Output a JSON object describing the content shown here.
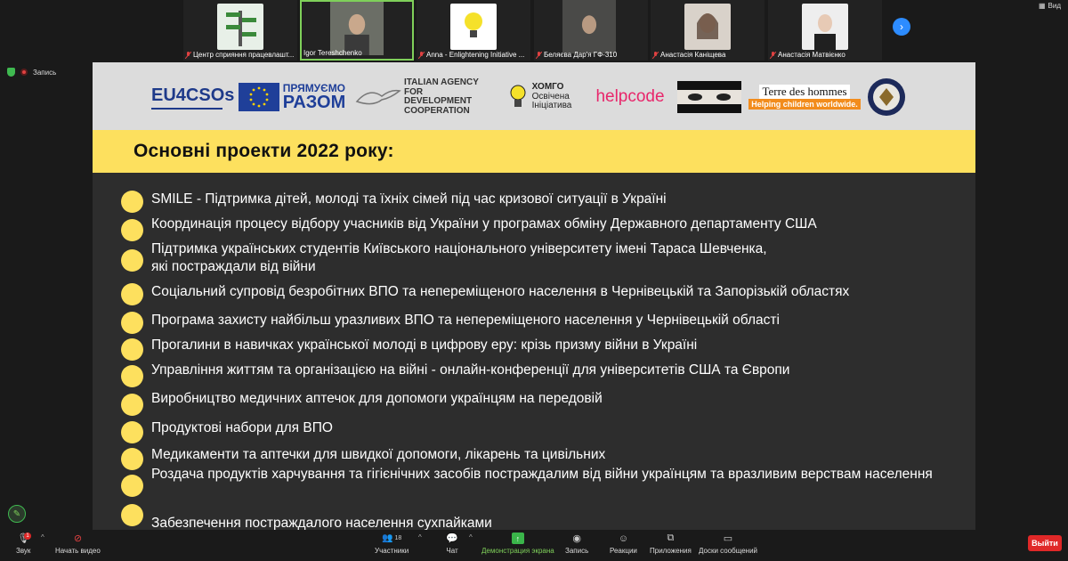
{
  "participants": [
    {
      "name": "Центр сприяння працевлашт...",
      "muted": true
    },
    {
      "name": "Igor Tereshchenko",
      "muted": false,
      "active": true
    },
    {
      "name": "Anna - Enlightening Initiative ...",
      "muted": true
    },
    {
      "name": "Беляєва Дар'я ГФ-310",
      "muted": true
    },
    {
      "name": "Анастасія Каніщева",
      "muted": true
    },
    {
      "name": "Анастасія Матвієнко",
      "muted": true
    }
  ],
  "view_label": "Вид",
  "recording_label": "Запись",
  "logos": {
    "eu4csos": "EU4CSOs",
    "pryamuemo": "ПРЯМУЄМО",
    "razom": "РАЗОМ",
    "italian1": "ITALIAN AGENCY",
    "italian2": "FOR DEVELOPMENT",
    "italian3": "COOPERATION",
    "khomho1": "ХОМГО",
    "khomho2": "Освічена",
    "khomho3": "Ініціатива",
    "helpcode": "helpcode",
    "tdh1": "Terre des hommes",
    "tdh2": "Helping children worldwide."
  },
  "slide_title": "Основні проекти 2022 року:",
  "projects": [
    "SMILE - Підтримка дітей, молоді та їхніх сімей під час кризової ситуації в Україні",
    "Координація процесу відбору учасників від України у програмах обміну Державного департаменту США",
    "Підтримка українських студентів Київського національного університету імені Тараса Шевченка, які постраждали від війни",
    "Соціальний супровід безробітних ВПО та непереміщеного населення в Чернівецькій та Запорізькій областях",
    "Програма захисту найбільш уразливих ВПО та непереміщеного населення у Чернівецькій області",
    "Прогалини в навичках української молоді в цифрову еру: крізь призму війни в Україні",
    "Управління життям та організацією на війні - онлайн-конференції для університетів США та Європи",
    "Виробництво медичних аптечок для допомоги українцям на передовій",
    "Продуктові набори для ВПО",
    "Медикаменти та аптечки для швидкої допомоги, лікарень та цивільних",
    "Роздача продуктів харчування та гігієнічних засобів постраждалим від війни українцям та вразливим верствам населення",
    "Забезпечення постраждалого населення сухпайками"
  ],
  "toolbar": {
    "sound": "Звук",
    "video": "Начать видео",
    "participants": "Участники",
    "participants_count": "18",
    "chat": "Чат",
    "share": "Демонстрация экрана",
    "record": "Запись",
    "reactions": "Реакции",
    "apps": "Приложения",
    "whiteboards": "Доски сообщений",
    "leave": "Выйти",
    "sound_badge": "1"
  }
}
